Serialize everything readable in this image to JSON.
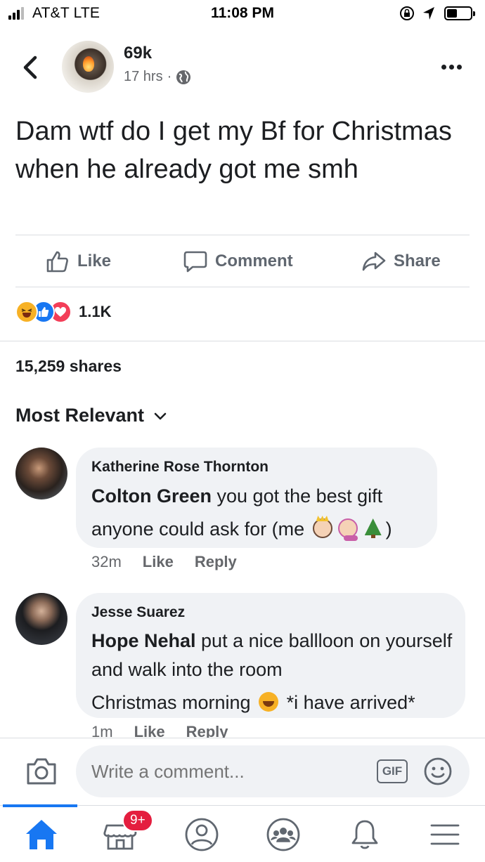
{
  "status_bar": {
    "carrier": "AT&T  LTE",
    "time": "11:08 PM"
  },
  "post": {
    "poster_name": "69k",
    "time_ago": "17 hrs",
    "separator": "·",
    "text": "Dam wtf do I get my Bf for Christmas when he already got me smh"
  },
  "actions": {
    "like": "Like",
    "comment": "Comment",
    "share": "Share"
  },
  "reactions": {
    "count": "1.1K"
  },
  "shares": "15,259 shares",
  "sort_label": "Most Relevant",
  "comments": [
    {
      "author": "Katherine Rose Thornton",
      "mention": "Colton Green",
      "text": " you got the best gift anyone could ask for (me ",
      "text_end": ")",
      "time": "32m",
      "like": "Like",
      "reply": "Reply"
    },
    {
      "author": "Jesse Suarez",
      "mention": "Hope Nehal",
      "text": " put a nice ballloon on yourself and walk into the room",
      "text_line3_a": "Christmas morning ",
      "text_line3_b": " *i have arrived*",
      "time": "1m",
      "like": "Like",
      "reply": "Reply"
    }
  ],
  "composer": {
    "placeholder": "Write a comment...",
    "gif_label": "GIF"
  },
  "nav": {
    "marketplace_badge": "9+"
  },
  "colors": {
    "accent": "#1877f2",
    "badge": "#e41e3f",
    "bubble": "#f0f2f5",
    "text_secondary": "#65676b"
  }
}
